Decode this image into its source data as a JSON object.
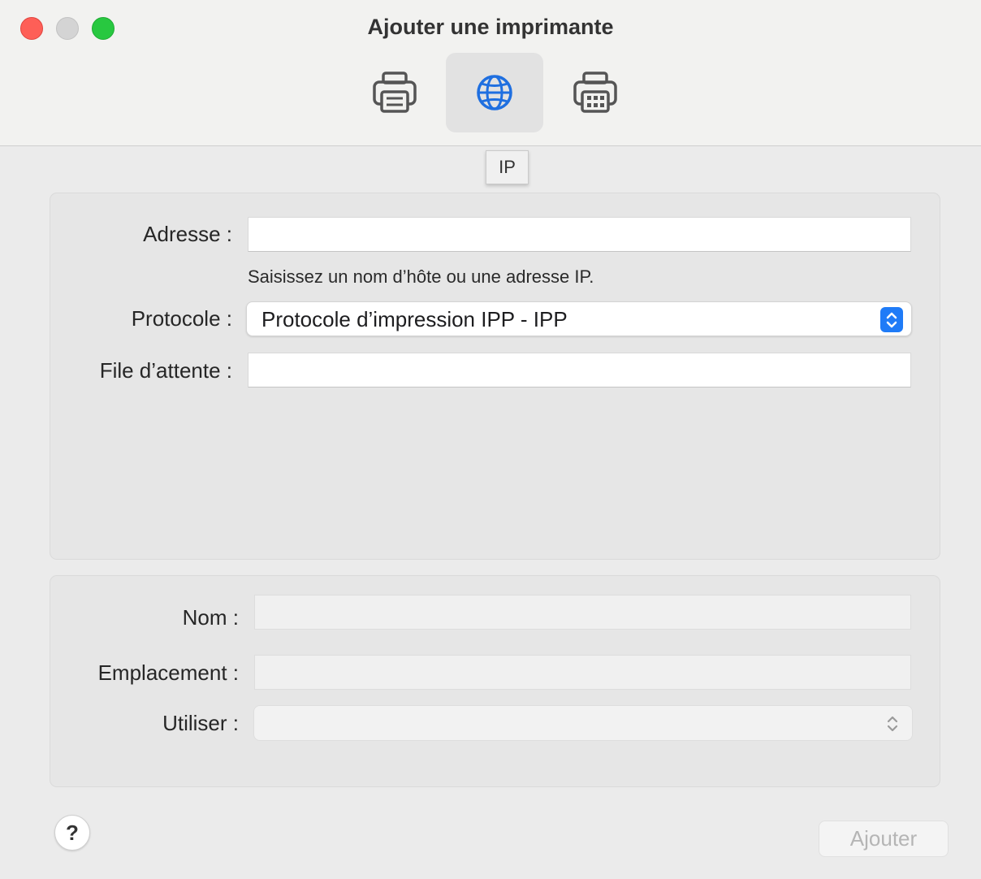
{
  "window": {
    "title": "Ajouter une imprimante"
  },
  "toolbar": {
    "items": [
      {
        "icon": "printer-icon",
        "selected": false
      },
      {
        "icon": "globe-icon",
        "selected": true
      },
      {
        "icon": "windows-printer-icon",
        "selected": false
      }
    ],
    "tooltip": "IP"
  },
  "connection": {
    "address_label": "Adresse :",
    "address_value": "",
    "address_hint": "Saisissez un nom d’hôte ou une adresse IP.",
    "protocol_label": "Protocole :",
    "protocol_value": "Protocole d’impression IPP - IPP",
    "queue_label": "File d’attente :",
    "queue_value": ""
  },
  "details": {
    "name_label": "Nom :",
    "name_value": "",
    "location_label": "Emplacement :",
    "location_value": "",
    "use_label": "Utiliser :",
    "use_value": ""
  },
  "footer": {
    "help_label": "?",
    "add_label": "Ajouter"
  },
  "colors": {
    "accent": "#1f7bf7",
    "close": "#fe5f57",
    "zoom": "#28c840"
  }
}
